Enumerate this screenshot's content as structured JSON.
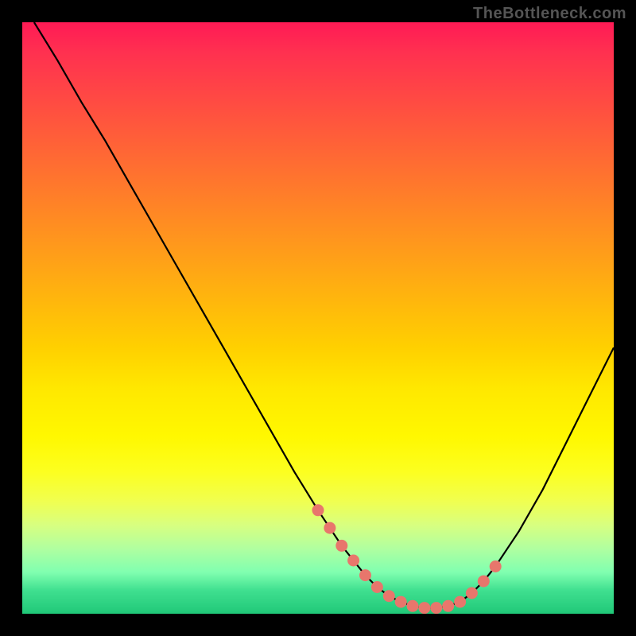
{
  "watermark": "TheBottleneck.com",
  "chart_data": {
    "type": "line",
    "title": "",
    "xlabel": "",
    "ylabel": "",
    "xlim": [
      0,
      100
    ],
    "ylim": [
      0,
      100
    ],
    "grid": false,
    "legend": false,
    "description": "Bottleneck curve with V-shaped minimum. X-axis implied as component performance ratio, Y-axis as bottleneck percentage. Rainbow vertical gradient background (red top = high bottleneck, green bottom = low/none).",
    "series": [
      {
        "name": "bottleneck-curve",
        "color": "#000000",
        "x": [
          2,
          6,
          10,
          14,
          18,
          22,
          26,
          30,
          34,
          38,
          42,
          46,
          50,
          54,
          58,
          60,
          62,
          64,
          66,
          68,
          70,
          72,
          74,
          76,
          78,
          80,
          84,
          88,
          92,
          96,
          100
        ],
        "y": [
          100,
          93.5,
          86.5,
          80,
          73,
          66,
          59,
          52,
          45,
          38,
          31,
          24,
          17.5,
          11.5,
          6.5,
          4.5,
          3,
          2,
          1.3,
          1,
          1,
          1.3,
          2,
          3.5,
          5.5,
          8,
          14,
          21,
          29,
          37,
          45
        ]
      },
      {
        "name": "optimal-markers",
        "color": "#e8766c",
        "type": "scatter",
        "x": [
          50,
          52,
          54,
          56,
          58,
          60,
          62,
          64,
          66,
          68,
          70,
          72,
          74,
          76,
          78,
          80
        ],
        "y": [
          17.5,
          14.5,
          11.5,
          9,
          6.5,
          4.5,
          3,
          2,
          1.3,
          1,
          1,
          1.3,
          2,
          3.5,
          5.5,
          8
        ]
      }
    ]
  }
}
